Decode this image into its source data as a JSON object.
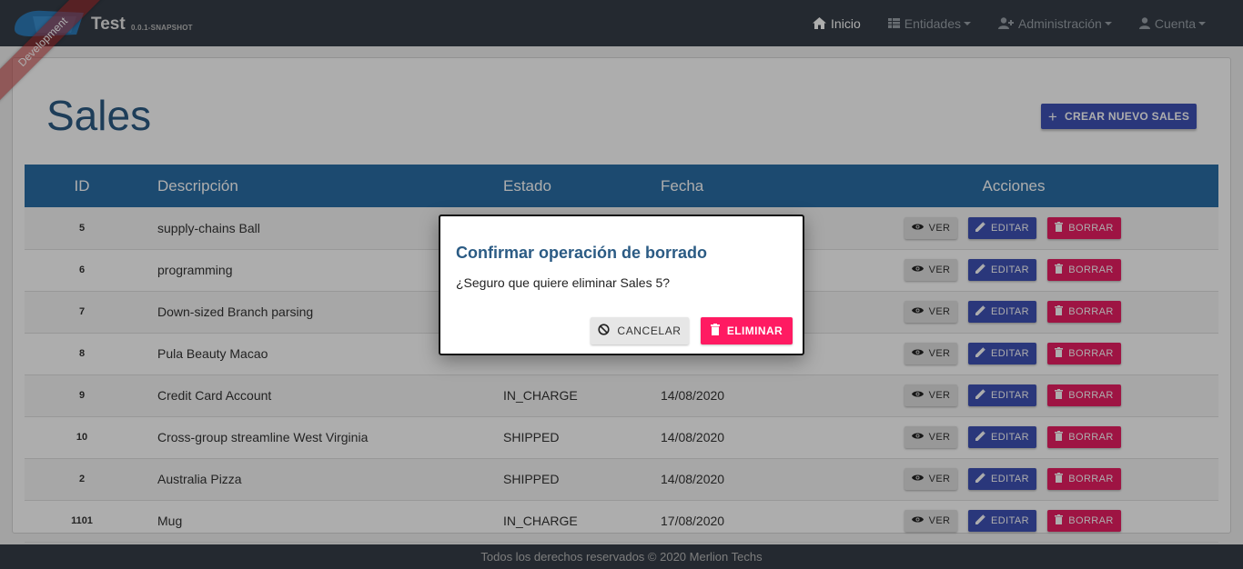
{
  "navbar": {
    "brand_title": "Test",
    "brand_version": "0.0.1-SNAPSHOT",
    "ribbon": "Development",
    "items": [
      {
        "label": "Inicio",
        "icon": "home-icon",
        "dropdown": false
      },
      {
        "label": "Entidades",
        "icon": "table-icon",
        "dropdown": true
      },
      {
        "label": "Administración",
        "icon": "user-plus-icon",
        "dropdown": true
      },
      {
        "label": "Cuenta",
        "icon": "user-icon",
        "dropdown": true
      }
    ]
  },
  "page": {
    "title": "Sales",
    "create_button": "CREAR NUEVO SALES"
  },
  "table": {
    "headers": [
      "ID",
      "Descripción",
      "Estado",
      "Fecha",
      "Acciones"
    ],
    "rows": [
      {
        "id": "5",
        "desc": "supply-chains Ball",
        "estado": "",
        "fecha": ""
      },
      {
        "id": "6",
        "desc": "programming",
        "estado": "",
        "fecha": ""
      },
      {
        "id": "7",
        "desc": "Down-sized Branch parsing",
        "estado": "",
        "fecha": ""
      },
      {
        "id": "8",
        "desc": "Pula Beauty Macao",
        "estado": "",
        "fecha": ""
      },
      {
        "id": "9",
        "desc": "Credit Card Account",
        "estado": "IN_CHARGE",
        "fecha": "14/08/2020"
      },
      {
        "id": "10",
        "desc": "Cross-group streamline West Virginia",
        "estado": "SHIPPED",
        "fecha": "14/08/2020"
      },
      {
        "id": "2",
        "desc": "Australia Pizza",
        "estado": "SHIPPED",
        "fecha": "14/08/2020"
      },
      {
        "id": "1101",
        "desc": "Mug",
        "estado": "IN_CHARGE",
        "fecha": "17/08/2020"
      }
    ],
    "actions": {
      "view": "VER",
      "edit": "EDITAR",
      "delete": "BORRAR"
    }
  },
  "footer": {
    "text": "Todos los derechos reservados © 2020 Merlion Techs"
  },
  "modal": {
    "title": "Confirmar operación de borrado",
    "body": "¿Seguro que quiere eliminar Sales 5?",
    "cancel": "CANCELAR",
    "confirm": "ELIMINAR"
  },
  "colors": {
    "navbar": "#353d47",
    "table_header": "#2a6ea6",
    "primary": "#3f51b5",
    "danger": "#e91e63",
    "title": "#2b5b84"
  }
}
